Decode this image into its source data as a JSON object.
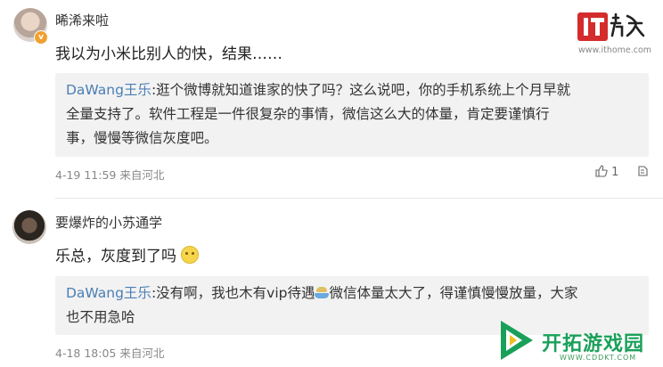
{
  "comments": [
    {
      "username": "晞浠来啦",
      "content": "我以为小米比别人的快，结果……",
      "reply": {
        "user": "DaWang王乐",
        "text_line1": ":逛个微博就知道谁家的快了吗？这么说吧，你的手机系统上个月早就",
        "text_line2": "全量支持了。软件工程是一件很复杂的事情，微信这么大的体量，肯定要谨慎行",
        "text_line3": "事，慢慢等微信灰度吧。"
      },
      "meta": "4-19 11:59 来自河北",
      "like_count": "1"
    },
    {
      "username": "要爆炸的小苏通学",
      "content": "乐总，灰度到了吗",
      "reply": {
        "user": "DaWang王乐",
        "text_line1_a": ":没有啊，我也木有vip待遇",
        "text_line1_b": "微信体量太大了，得谨慎慢慢放量，大家",
        "text_line2": "也不用急哈"
      },
      "meta": "4-18 18:05 来自河北"
    }
  ],
  "watermarks": {
    "ithome_logo_text": "IT之家",
    "ithome_url": "www.ithome.com",
    "cddkt_title": "开拓游戏园",
    "cddkt_url": "WWW.CDDKT.COM"
  },
  "colors": {
    "reply_user": "#4a7fb5",
    "reply_bg": "#f2f2f2",
    "ithome_red": "#d42c2c",
    "cddkt_green": "#1aa05a"
  }
}
